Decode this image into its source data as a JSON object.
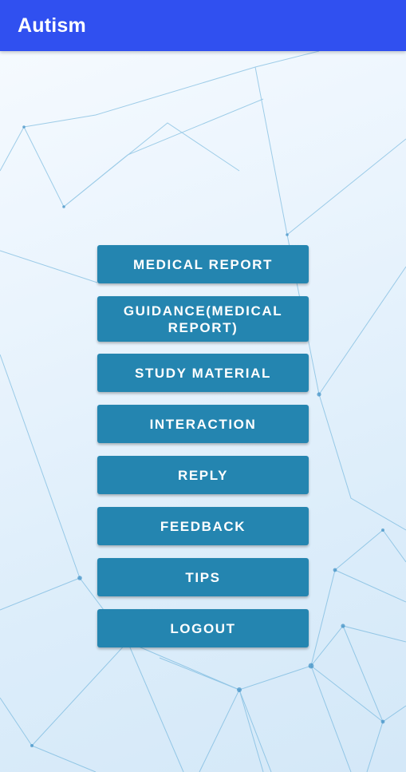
{
  "app_bar": {
    "title": "Autism"
  },
  "menu": {
    "medical_report": "MEDICAL REPORT",
    "guidance": "GUIDANCE(MEDICAL REPORT)",
    "study_material": "STUDY MATERIAL",
    "interaction": "INTERACTION",
    "reply": "REPLY",
    "feedback": "FEEDBACK",
    "tips": "TIPS",
    "logout": "LOGOUT"
  },
  "colors": {
    "app_bar": "#3050f0",
    "button": "#2485b0",
    "button_text": "#ffffff",
    "network_lines": "#5aa9d6"
  }
}
